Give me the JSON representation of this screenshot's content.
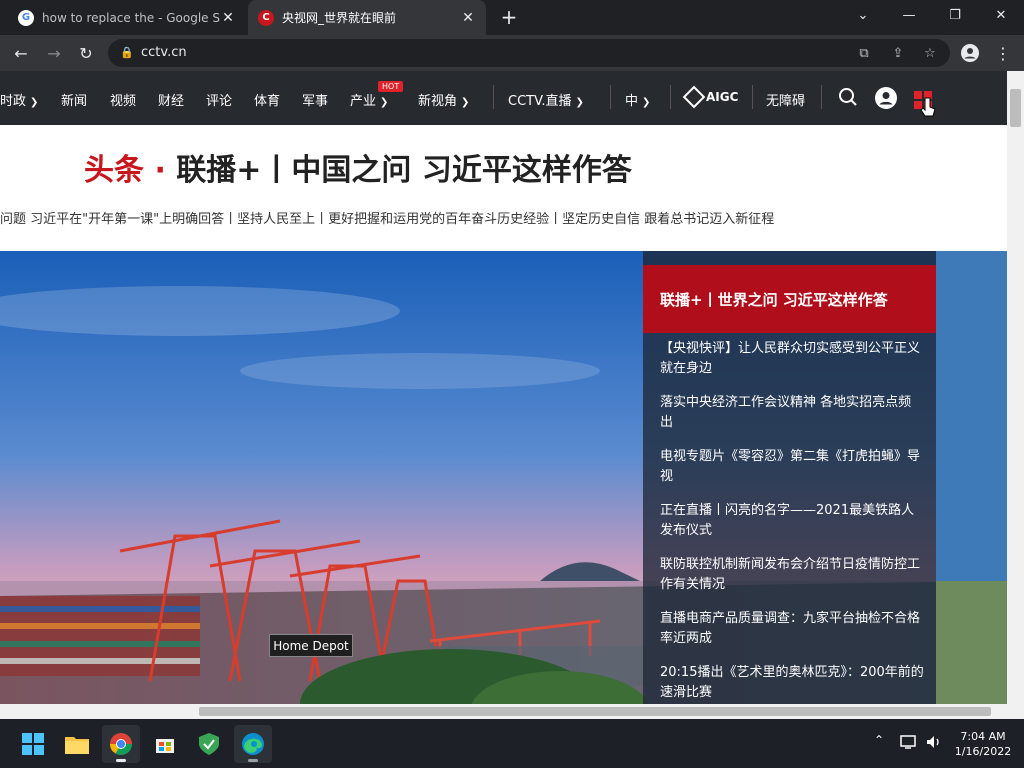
{
  "browser": {
    "tabs": [
      {
        "title": "how to replace the - Google Sear"
      },
      {
        "title": "央视网_世界就在眼前"
      }
    ],
    "url": "cctv.cn"
  },
  "nav": {
    "items": [
      "时政",
      "新闻",
      "视频",
      "财经",
      "评论",
      "体育",
      "军事",
      "产业",
      "新视角",
      "CCTV.直播",
      "中",
      "无障碍"
    ],
    "hot_badge": "HOT",
    "aigc_label": "AIGC"
  },
  "headline": {
    "prefix": "头条 ·",
    "title": "联播+丨中国之问 习近平这样作答",
    "subline": "问题 习近平在\"开年第一课\"上明确回答丨坚持人民至上丨更好把握和运用党的百年奋斗历史经验丨坚定历史自信 跟着总书记迈入新征程"
  },
  "sidepanel": {
    "header": "联播+丨世界之问 习近平这样作答",
    "news": [
      "【央视快评】让人民群众切实感受到公平正义就在身边",
      "落实中央经济工作会议精神 各地实招亮点频出",
      "电视专题片《零容忍》第二集《打虎拍蝇》导视",
      "正在直播丨闪亮的名字——2021最美铁路人发布仪式",
      "联防联控机制新闻发布会介绍节日疫情防控工作有关情况",
      "直播电商产品质量调查：九家平台抽检不合格率近两成",
      "20:15播出《艺术里的奥林匹克》：200年前的速滑比赛"
    ]
  },
  "tooltip": "Home Depot",
  "taskbar": {
    "time": "7:04 AM",
    "date": "1/16/2022"
  },
  "colors": {
    "accent_red": "#c8161d",
    "nav_bg": "#272b30"
  }
}
